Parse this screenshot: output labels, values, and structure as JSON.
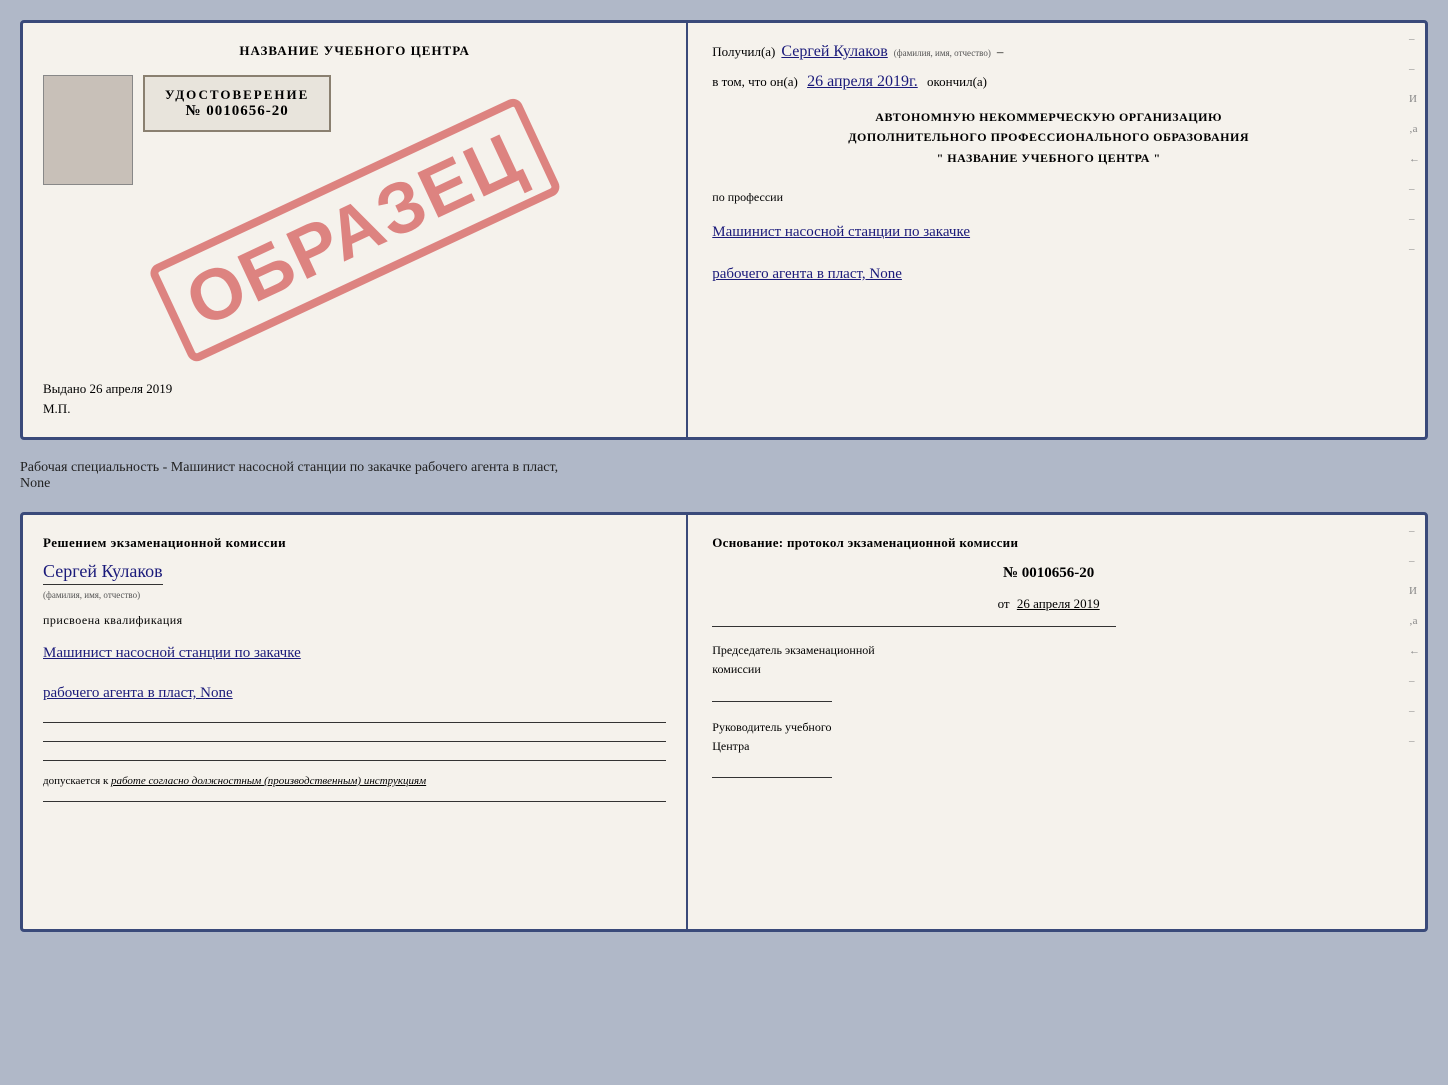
{
  "top_left": {
    "title": "НАЗВАНИЕ УЧЕБНОГО ЦЕНТРА",
    "stamp": "ОБРАЗЕЦ",
    "udostoverenie": {
      "label": "УДОСТОВЕРЕНИЕ",
      "number": "№ 0010656-20"
    },
    "vydano": "Выдано 26 апреля 2019",
    "mp": "М.П."
  },
  "top_right": {
    "poluchil_label": "Получил(а)",
    "poluchil_name": "Сергей Кулаков",
    "fio_hint": "(фамилия, имя, отчество)",
    "dash": "–",
    "vtom_label": "в том, что он(а)",
    "date_handwritten": "26 апреля 2019г.",
    "okonchil": "окончил(а)",
    "org_line1": "АВТОНОМНУЮ НЕКОММЕРЧЕСКУЮ ОРГАНИЗАЦИЮ",
    "org_line2": "ДОПОЛНИТЕЛЬНОГО ПРОФЕССИОНАЛЬНОГО ОБРАЗОВАНИЯ",
    "org_line3": "\" НАЗВАНИЕ УЧЕБНОГО ЦЕНТРА \"",
    "po_professii": "по профессии",
    "profession_line1": "Машинист насосной станции по закачке",
    "profession_line2": "рабочего агента в пласт, None"
  },
  "below_doc": {
    "text": "Рабочая специальность - Машинист насосной станции по закачке рабочего агента в пласт,",
    "text2": "None"
  },
  "bottom_left": {
    "resheniem": "Решением экзаменационной комиссии",
    "name_handwritten": "Сергей Кулаков",
    "fio_hint": "(фамилия, имя, отчество)",
    "prisvoyena": "присвоена квалификация",
    "qualification_line1": "Машинист насосной станции по закачке",
    "qualification_line2": "рабочего агента в пласт, None",
    "dopuskaetsya": "допускается к",
    "dopusk_text": "работе согласно должностным (производственным) инструкциям"
  },
  "bottom_right": {
    "osnov_label": "Основание: протокол экзаменационной комиссии",
    "protocol_num": "№ 0010656-20",
    "ot_label": "от",
    "ot_date": "26 апреля 2019",
    "predsedatel_label": "Председатель экзаменационной",
    "predsedatel_label2": "комиссии",
    "rukovoditel_label": "Руководитель учебного",
    "rukovoditel_label2": "Центра"
  },
  "dashes": [
    "–",
    "–",
    "–",
    "И",
    "‚а",
    "←",
    "–",
    "–",
    "–",
    "–"
  ]
}
